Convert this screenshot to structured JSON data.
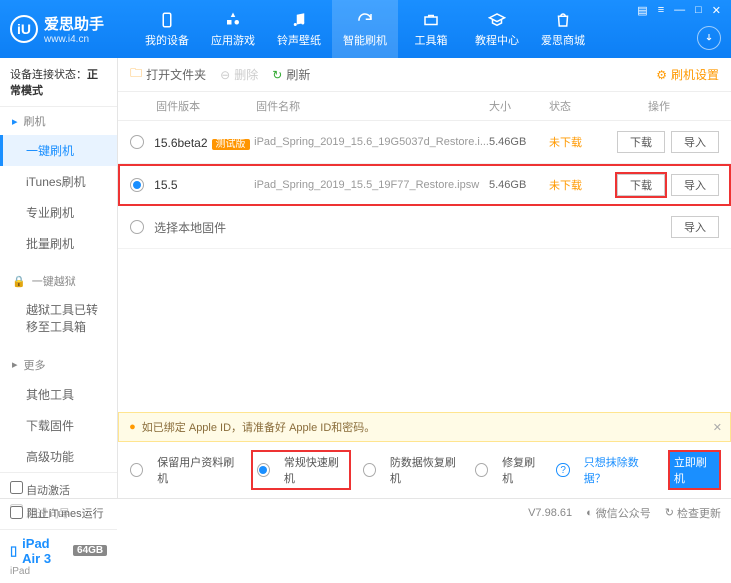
{
  "brand": {
    "name": "爱思助手",
    "url": "www.i4.cn",
    "logo_letter": "iU"
  },
  "nav": [
    {
      "label": "我的设备"
    },
    {
      "label": "应用游戏"
    },
    {
      "label": "铃声壁纸"
    },
    {
      "label": "智能刷机"
    },
    {
      "label": "工具箱"
    },
    {
      "label": "教程中心"
    },
    {
      "label": "爱思商城"
    }
  ],
  "conn_status_label": "设备连接状态：",
  "conn_status_value": "正常模式",
  "sidebar": {
    "g1": {
      "title": "刷机"
    },
    "items1": [
      "一键刷机",
      "iTunes刷机",
      "专业刷机",
      "批量刷机"
    ],
    "g2": {
      "title": "一键越狱"
    },
    "jailbreak_msg": "越狱工具已转移至工具箱",
    "g3": {
      "title": "更多"
    },
    "items3": [
      "其他工具",
      "下载固件",
      "高级功能"
    ]
  },
  "auto_activate": "自动激活",
  "skip_guide": "跳过向导",
  "device": {
    "name": "iPad Air 3",
    "storage": "64GB",
    "type": "iPad"
  },
  "toolbar": {
    "open": "打开文件夹",
    "delete": "删除",
    "refresh": "刷新",
    "settings": "刷机设置"
  },
  "columns": {
    "ver": "固件版本",
    "name": "固件名称",
    "size": "大小",
    "status": "状态",
    "op": "操作"
  },
  "rows": [
    {
      "ver": "15.6beta2",
      "tag": "测试版",
      "name": "iPad_Spring_2019_15.6_19G5037d_Restore.i...",
      "size": "5.46GB",
      "status": "未下载",
      "selected": false
    },
    {
      "ver": "15.5",
      "tag": "",
      "name": "iPad_Spring_2019_15.5_19F77_Restore.ipsw",
      "size": "5.46GB",
      "status": "未下载",
      "selected": true
    }
  ],
  "local_fw": "选择本地固件",
  "btn_download": "下载",
  "btn_import": "导入",
  "notice": "如已绑定 Apple ID，请准备好 Apple ID和密码。",
  "modes": [
    "保留用户资料刷机",
    "常规快速刷机",
    "防数据恢复刷机",
    "修复刷机"
  ],
  "exclude_link": "只想抹除数据？",
  "go": "立即刷机",
  "footer": {
    "block_itunes": "阻止iTunes运行",
    "version": "V7.98.61",
    "wechat": "微信公众号",
    "update": "检查更新"
  }
}
